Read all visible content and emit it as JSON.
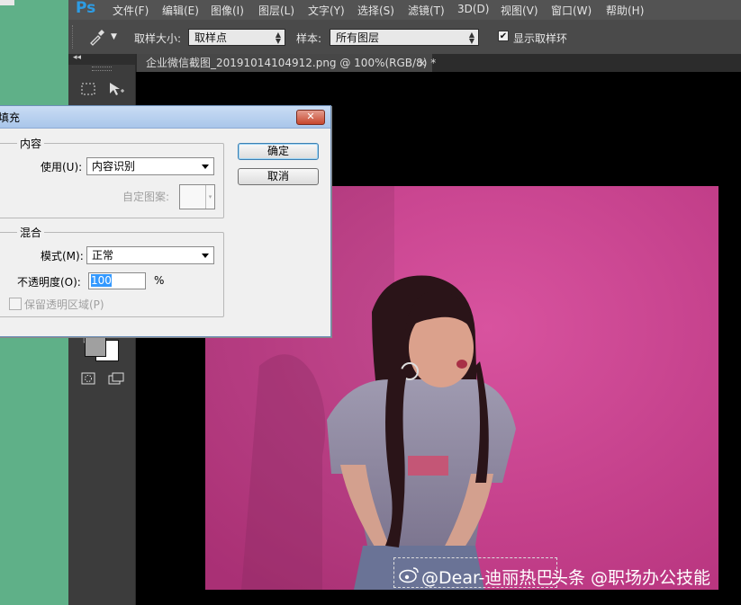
{
  "app": {
    "logo": "Ps"
  },
  "menubar": {
    "items": [
      "文件(F)",
      "编辑(E)",
      "图像(I)",
      "图层(L)",
      "文字(Y)",
      "选择(S)",
      "滤镜(T)",
      "3D(D)",
      "视图(V)",
      "窗口(W)",
      "帮助(H)"
    ]
  },
  "options": {
    "tool_icon": "eyedropper-icon",
    "sample_size_label": "取样大小:",
    "sample_size_value": "取样点",
    "sample_label": "样本:",
    "sample_value": "所有图层",
    "show_ring_checked": true,
    "show_ring_label": "显示取样环"
  },
  "document": {
    "tab_title": "企业微信截图_20191014104912.png @ 100%(RGB/8) *",
    "tab_close": "×",
    "watermark_main": "@Dear-迪丽热巴",
    "watermark_tag": "头条 @职场办公技能"
  },
  "dialog": {
    "title": "填充",
    "close": "✕",
    "content_group": "内容",
    "use_label": "使用(U):",
    "use_value": "内容识别",
    "pattern_label": "自定图案:",
    "blend_group": "混合",
    "mode_label": "模式(M):",
    "mode_value": "正常",
    "opacity_label": "不透明度(O):",
    "opacity_value": "100",
    "opacity_unit": "%",
    "preserve_label": "保留透明区域(P)",
    "preserve_checked": false,
    "ok": "确定",
    "cancel": "取消"
  },
  "colors": {
    "accent": "#2d9ce4",
    "canvas_pink": "#d84aa0",
    "desktop_green": "#5fb088"
  }
}
